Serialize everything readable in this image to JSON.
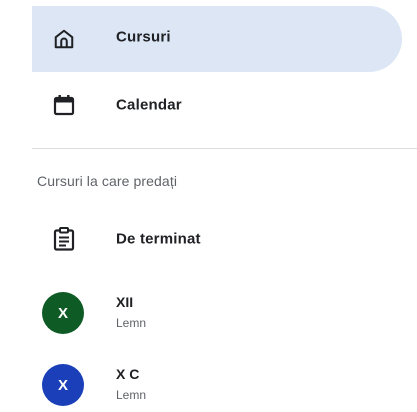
{
  "colors": {
    "active_bg": "#dce6f5",
    "avatar_xii": "#0f5b25",
    "avatar_xc": "#1a3fb8",
    "text_primary": "#202124",
    "text_secondary": "#5f6368",
    "divider": "#dadce0"
  },
  "nav": {
    "items": [
      {
        "label": "Cursuri",
        "icon": "home-icon",
        "active": true
      },
      {
        "label": "Calendar",
        "icon": "calendar-icon",
        "active": false
      }
    ]
  },
  "teaching": {
    "heading": "Cursuri la care predați",
    "todo": {
      "label": "De terminat",
      "icon": "clipboard-icon"
    },
    "courses": [
      {
        "initial": "X",
        "name": "XII",
        "section": "Lemn"
      },
      {
        "initial": "X",
        "name": "X C",
        "section": "Lemn"
      }
    ]
  }
}
